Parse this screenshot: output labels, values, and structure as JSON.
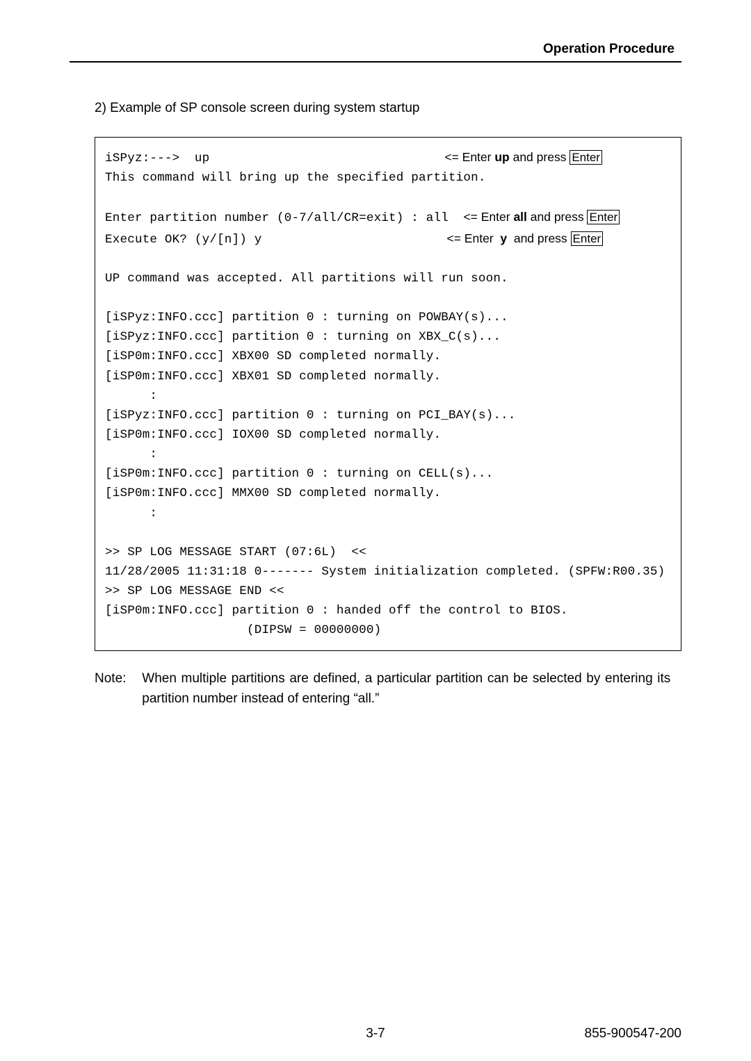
{
  "header": {
    "title": "Operation Procedure"
  },
  "body": {
    "caption": "2)  Example of SP console screen during system startup"
  },
  "console": {
    "l1a": "iSPyz:--->  up",
    "l1b": "<= Enter ",
    "l1c": "up",
    "l1d": " and press ",
    "l1e": "Enter",
    "l2": "This command will bring up the specified partition.",
    "l3": "",
    "l4a": "Enter partition number (0-7/all/CR=exit) : all  ",
    "l4b": "<= Enter ",
    "l4c": "all",
    "l4d": " and press ",
    "l4e": "Enter",
    "l5a": "Execute OK? (y/[n]) y",
    "l5b": "<= Enter ",
    "l5c": " y ",
    "l5d": " and press ",
    "l5e": "Enter",
    "l6": "",
    "l7": "UP command was accepted. All partitions will run soon.",
    "l8": "",
    "l9": "[iSPyz:INFO.ccc] partition 0 : turning on POWBAY(s)...",
    "l10": "[iSPyz:INFO.ccc] partition 0 : turning on XBX_C(s)...",
    "l11": "[iSP0m:INFO.ccc] XBX00 SD completed normally.",
    "l12": "[iSP0m:INFO.ccc] XBX01 SD completed normally.",
    "l13": "      :",
    "l14": "[iSPyz:INFO.ccc] partition 0 : turning on PCI_BAY(s)...",
    "l15": "[iSP0m:INFO.ccc] IOX00 SD completed normally.",
    "l16": "      :",
    "l17": "[iSP0m:INFO.ccc] partition 0 : turning on CELL(s)...",
    "l18": "[iSP0m:INFO.ccc] MMX00 SD completed normally.",
    "l19": "      :",
    "l20": "",
    "l21": ">> SP LOG MESSAGE START (07:6L)  <<",
    "l22": "11/28/2005 11:31:18 0------- System initialization completed. (SPFW:R00.35)",
    "l23": ">> SP LOG MESSAGE END <<",
    "l24": "[iSP0m:INFO.ccc] partition 0 : handed off the control to BIOS.",
    "l25": "                   (DIPSW = 00000000)"
  },
  "note": {
    "label": "Note:",
    "text": "When multiple partitions are defined, a particular partition can be selected by entering its partition number instead of entering “all.”"
  },
  "footer": {
    "page": "3-7",
    "docnum": "855-900547-200"
  }
}
